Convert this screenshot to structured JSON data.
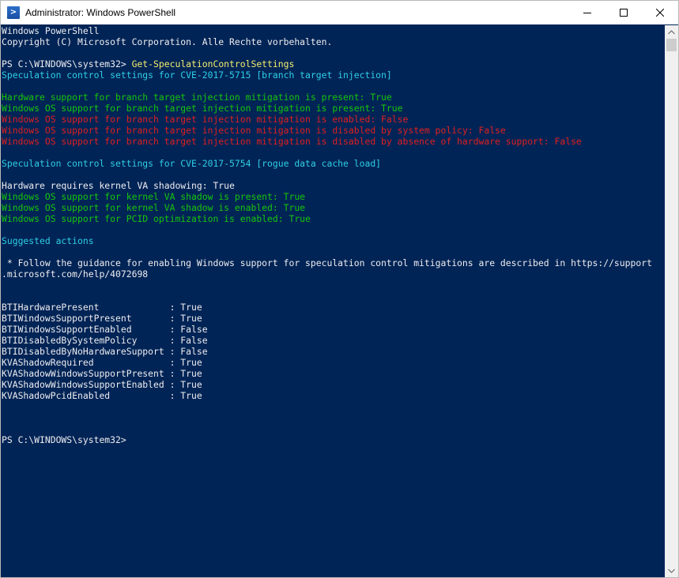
{
  "window": {
    "title": "Administrator: Windows PowerShell",
    "icon_glyph": ">"
  },
  "caption_buttons": {
    "minimize": "minimize-icon",
    "maximize": "maximize-icon",
    "close": "close-icon"
  },
  "colors": {
    "console_background": "#012456",
    "default_text": "#eeedf0",
    "cyan": "#2fcfe6",
    "green": "#16c60c",
    "red": "#e31f1f",
    "yellow": "#f3ee6d"
  },
  "console": {
    "lines": [
      {
        "segments": [
          {
            "text": "Windows PowerShell",
            "color": "default"
          }
        ]
      },
      {
        "segments": [
          {
            "text": "Copyright (C) Microsoft Corporation. Alle Rechte vorbehalten.",
            "color": "default"
          }
        ]
      },
      {
        "segments": []
      },
      {
        "segments": [
          {
            "text": "PS C:\\WINDOWS\\system32> ",
            "color": "default"
          },
          {
            "text": "Get-SpeculationControlSettings",
            "color": "yellow"
          }
        ]
      },
      {
        "segments": [
          {
            "text": "Speculation control settings for CVE-2017-5715 [branch target injection]",
            "color": "cyan"
          }
        ]
      },
      {
        "segments": []
      },
      {
        "segments": [
          {
            "text": "Hardware support for branch target injection mitigation is present: True",
            "color": "green"
          }
        ]
      },
      {
        "segments": [
          {
            "text": "Windows OS support for branch target injection mitigation is present: True",
            "color": "green"
          }
        ]
      },
      {
        "segments": [
          {
            "text": "Windows OS support for branch target injection mitigation is enabled: False",
            "color": "red"
          }
        ]
      },
      {
        "segments": [
          {
            "text": "Windows OS support for branch target injection mitigation is disabled by system policy: False",
            "color": "red"
          }
        ]
      },
      {
        "segments": [
          {
            "text": "Windows OS support for branch target injection mitigation is disabled by absence of hardware support: False",
            "color": "red"
          }
        ]
      },
      {
        "segments": []
      },
      {
        "segments": [
          {
            "text": "Speculation control settings for CVE-2017-5754 [rogue data cache load]",
            "color": "cyan"
          }
        ]
      },
      {
        "segments": []
      },
      {
        "segments": [
          {
            "text": "Hardware requires kernel VA shadowing: True",
            "color": "default"
          }
        ]
      },
      {
        "segments": [
          {
            "text": "Windows OS support for kernel VA shadow is present: True",
            "color": "green"
          }
        ]
      },
      {
        "segments": [
          {
            "text": "Windows OS support for kernel VA shadow is enabled: True",
            "color": "green"
          }
        ]
      },
      {
        "segments": [
          {
            "text": "Windows OS support for PCID optimization is enabled: True",
            "color": "green"
          }
        ]
      },
      {
        "segments": []
      },
      {
        "segments": [
          {
            "text": "Suggested actions",
            "color": "cyan"
          }
        ]
      },
      {
        "segments": []
      },
      {
        "segments": [
          {
            "text": " * Follow the guidance for enabling Windows support for speculation control mitigations are described in https://support",
            "color": "default"
          }
        ]
      },
      {
        "segments": [
          {
            "text": ".microsoft.com/help/4072698",
            "color": "default"
          }
        ]
      },
      {
        "segments": []
      },
      {
        "segments": []
      },
      {
        "segments": [
          {
            "text": "BTIHardwarePresent             : True",
            "color": "default"
          }
        ]
      },
      {
        "segments": [
          {
            "text": "BTIWindowsSupportPresent       : True",
            "color": "default"
          }
        ]
      },
      {
        "segments": [
          {
            "text": "BTIWindowsSupportEnabled       : False",
            "color": "default"
          }
        ]
      },
      {
        "segments": [
          {
            "text": "BTIDisabledBySystemPolicy      : False",
            "color": "default"
          }
        ]
      },
      {
        "segments": [
          {
            "text": "BTIDisabledByNoHardwareSupport : False",
            "color": "default"
          }
        ]
      },
      {
        "segments": [
          {
            "text": "KVAShadowRequired              : True",
            "color": "default"
          }
        ]
      },
      {
        "segments": [
          {
            "text": "KVAShadowWindowsSupportPresent : True",
            "color": "default"
          }
        ]
      },
      {
        "segments": [
          {
            "text": "KVAShadowWindowsSupportEnabled : True",
            "color": "default"
          }
        ]
      },
      {
        "segments": [
          {
            "text": "KVAShadowPcidEnabled           : True",
            "color": "default"
          }
        ]
      },
      {
        "segments": []
      },
      {
        "segments": []
      },
      {
        "segments": []
      },
      {
        "segments": [
          {
            "text": "PS C:\\WINDOWS\\system32>",
            "color": "default"
          }
        ]
      }
    ]
  }
}
